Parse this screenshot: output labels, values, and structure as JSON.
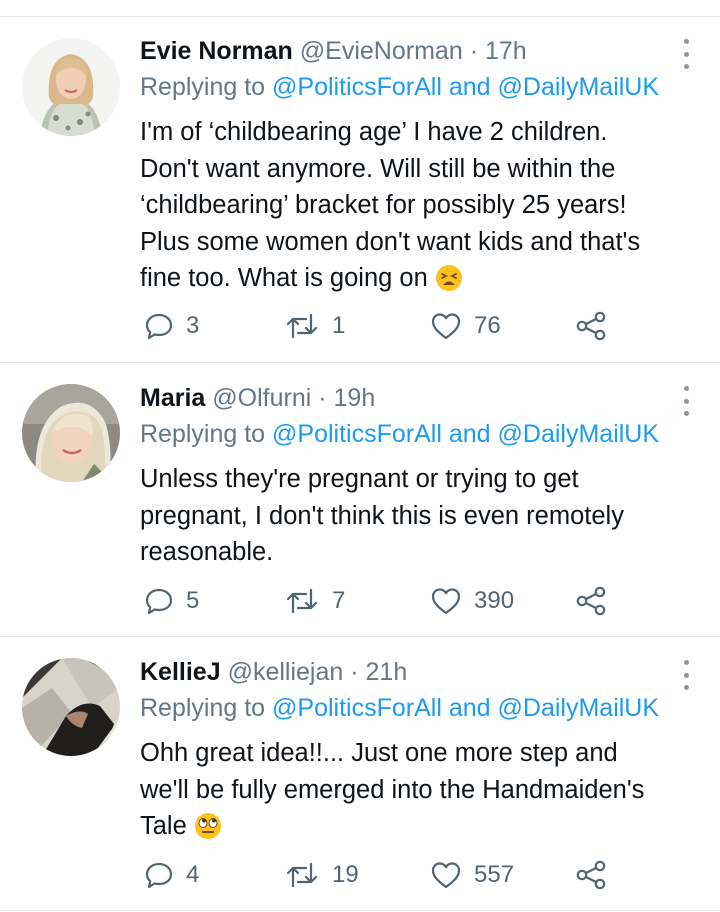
{
  "tweets": [
    {
      "name": "Evie Norman",
      "handle": "@EvieNorman",
      "separator": "·",
      "time": "17h",
      "reply_prefix": "Replying to",
      "reply_user1": "@PoliticsForAll",
      "reply_and": "and",
      "reply_user2": "@DailyMailUK",
      "text_lines": [
        "I'm of ‘childbearing age’ I have 2 children.",
        "Don't want anymore. Will still be within the",
        "‘childbearing’ bracket for possibly 25 years!",
        "Plus some women don't want kids and that's",
        "fine too. What is going on"
      ],
      "emoji": "weary-face",
      "replies": "3",
      "retweets": "1",
      "likes": "76"
    },
    {
      "name": "Maria",
      "handle": "@Olfurni",
      "separator": "·",
      "time": "19h",
      "reply_prefix": "Replying to",
      "reply_user1": "@PoliticsForAll",
      "reply_and": "and",
      "reply_user2": "@DailyMailUK",
      "text_lines": [
        "Unless they're pregnant or trying to get",
        "pregnant, I don't think this is even remotely",
        "reasonable."
      ],
      "replies": "5",
      "retweets": "7",
      "likes": "390"
    },
    {
      "name": "KellieJ",
      "handle": "@kelliejan",
      "separator": "·",
      "time": "21h",
      "reply_prefix": "Replying to",
      "reply_user1": "@PoliticsForAll",
      "reply_and": "and",
      "reply_user2": "@DailyMailUK",
      "text_lines": [
        "Ohh great idea!!... Just one more step and",
        "we'll be fully emerged into the Handmaiden's",
        "Tale"
      ],
      "emoji": "face-with-rolling-eyes",
      "replies": "4",
      "retweets": "19",
      "likes": "557"
    }
  ],
  "colors": {
    "link": "#1d9bf0",
    "secondary_text": "#657786",
    "divider": "#e6e9ec"
  }
}
